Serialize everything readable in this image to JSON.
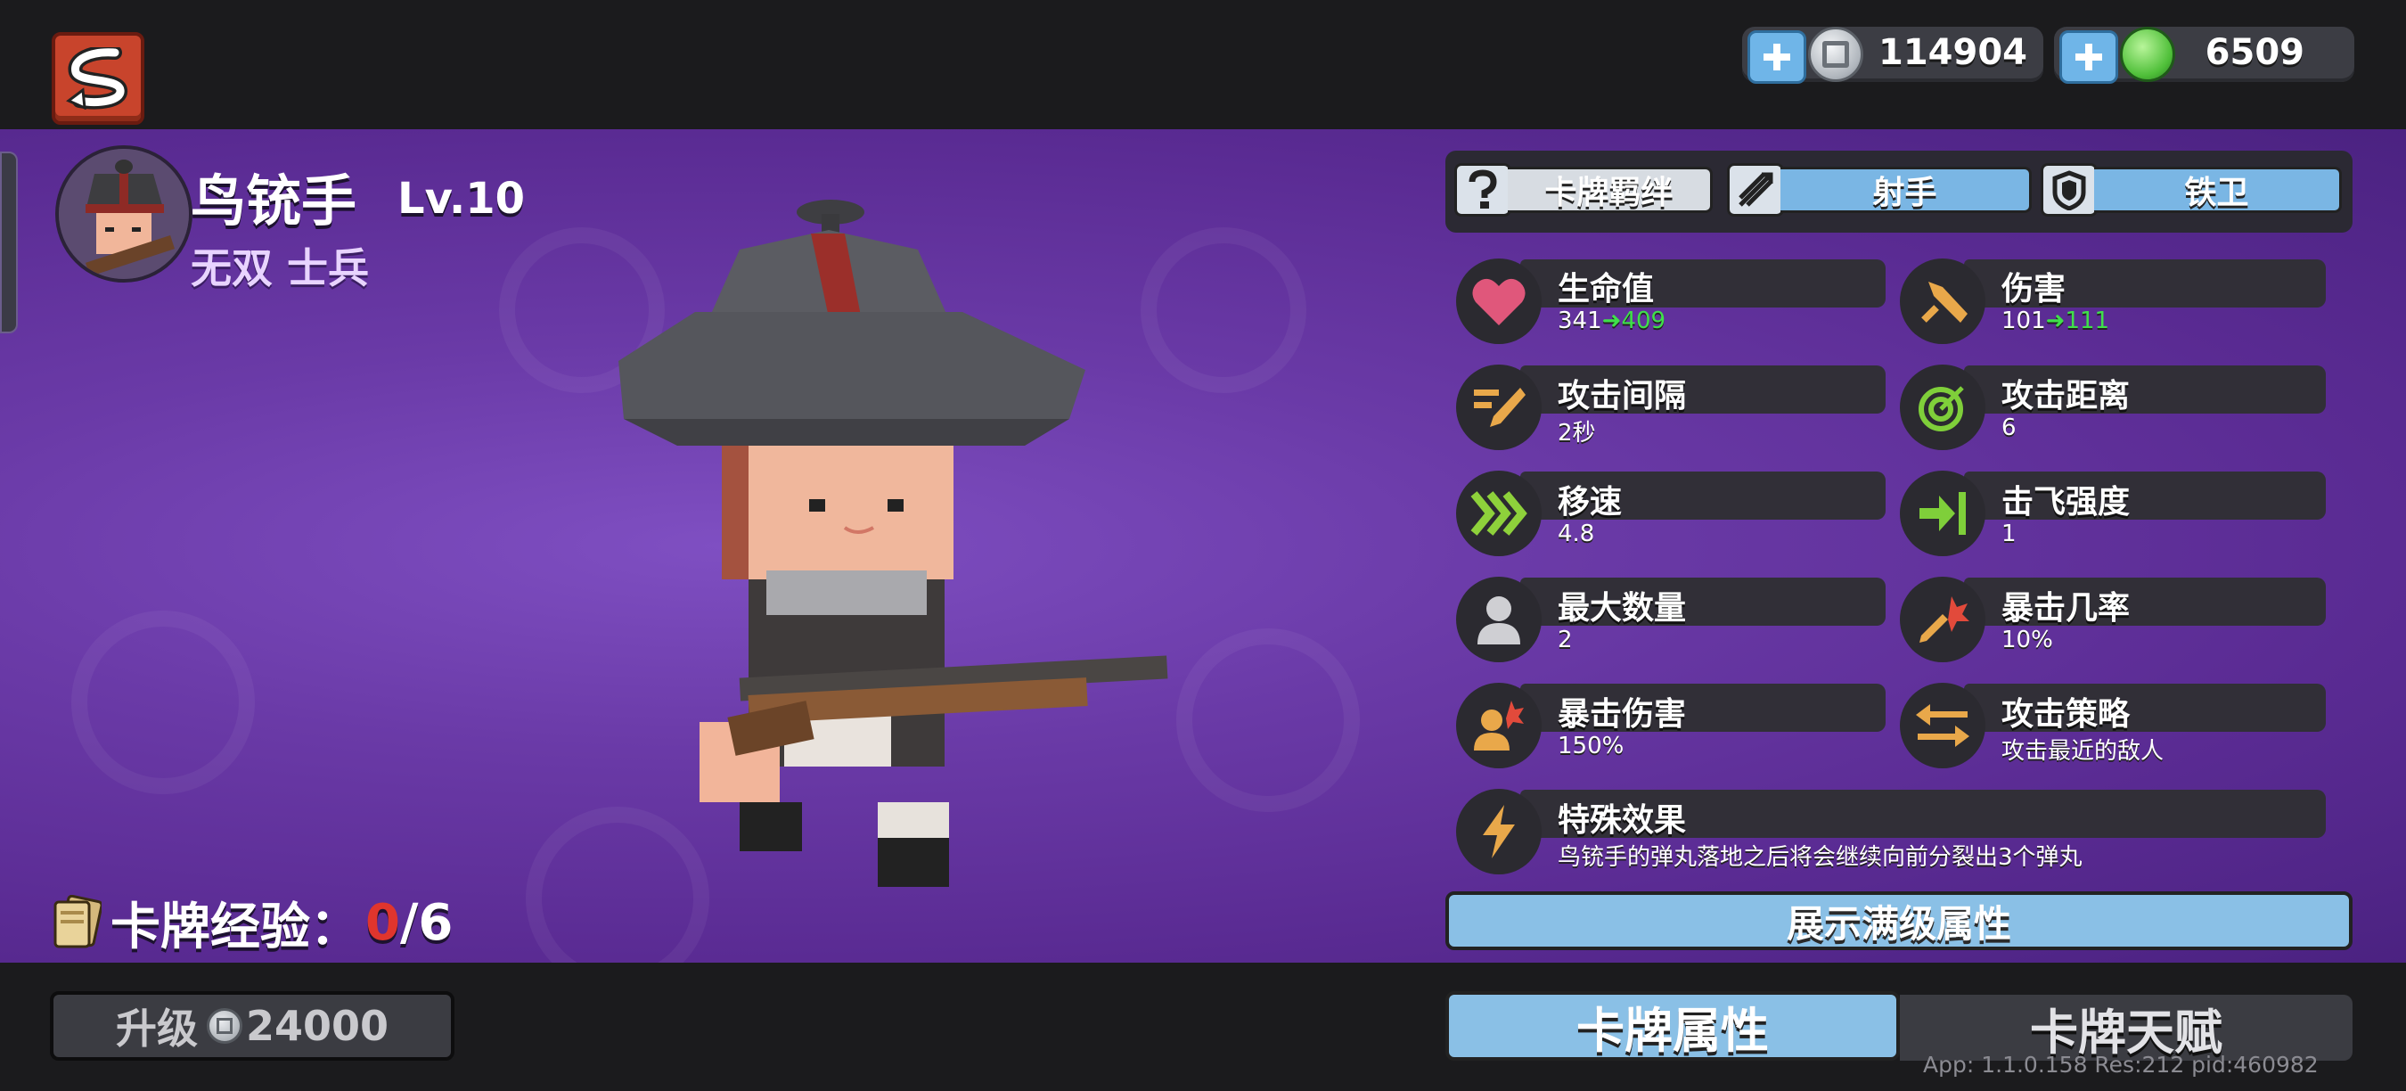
{
  "currency": {
    "silver": "114904",
    "gems": "6509"
  },
  "unit": {
    "name": "鸟铳手",
    "level": "Lv.10",
    "rarity": "无双 士兵",
    "card_exp_label": "卡牌经验：",
    "card_exp_current": "0",
    "card_exp_sep": "/",
    "card_exp_max": "6"
  },
  "tags": [
    {
      "label": "卡牌羁绊",
      "icon": "question-icon",
      "color": "#d7dce2"
    },
    {
      "label": "射手",
      "icon": "arrows-icon",
      "color": "#7ab6e4"
    },
    {
      "label": "铁卫",
      "icon": "shield-icon",
      "color": "#7ab6e4"
    }
  ],
  "stats": {
    "hp": {
      "name": "生命值",
      "old": "341",
      "new": "409",
      "icon": "heart-icon"
    },
    "damage": {
      "name": "伤害",
      "old": "101",
      "new": "111",
      "icon": "sword-icon"
    },
    "attack_interval": {
      "name": "攻击间隔",
      "value": "2秒",
      "icon": "speed-sword-icon"
    },
    "attack_range": {
      "name": "攻击距离",
      "value": "6",
      "icon": "target-icon"
    },
    "move_speed": {
      "name": "移速",
      "value": "4.8",
      "icon": "chevrons-icon"
    },
    "knockback": {
      "name": "击飞强度",
      "value": "1",
      "icon": "knockback-icon"
    },
    "max_count": {
      "name": "最大数量",
      "value": "2",
      "icon": "person-icon"
    },
    "crit_chance": {
      "name": "暴击几率",
      "value": "10%",
      "icon": "crit-sword-icon"
    },
    "crit_damage": {
      "name": "暴击伤害",
      "value": "150%",
      "icon": "crit-person-icon"
    },
    "strategy": {
      "name": "攻击策略",
      "value": "攻击最近的敌人",
      "icon": "swap-arrows-icon"
    },
    "special": {
      "name": "特殊效果",
      "value": "鸟铳手的弹丸落地之后将会继续向前分裂出3个弹丸",
      "icon": "lightning-icon"
    }
  },
  "buttons": {
    "show_max": "展示满级属性",
    "upgrade_label": "升级",
    "upgrade_cost": "24000",
    "tab_attributes": "卡牌属性",
    "tab_talents": "卡牌天赋"
  },
  "version": "App: 1.1.0.158 Res:212 pid:460982"
}
